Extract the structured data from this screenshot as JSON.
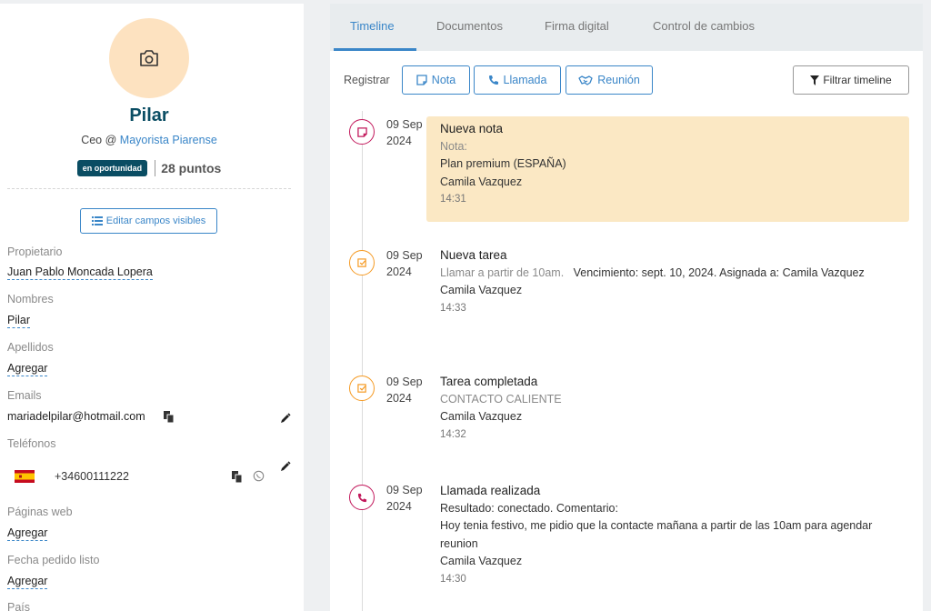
{
  "profile": {
    "name": "Pilar",
    "role": "Ceo @",
    "company": "Mayorista Piarense",
    "badge": "en oportunidad",
    "points": "28 puntos",
    "edit_fields_label": "Editar campos visibles"
  },
  "fields": {
    "owner_label": "Propietario",
    "owner_value": "Juan Pablo Moncada Lopera",
    "names_label": "Nombres",
    "names_value": "Pilar",
    "surnames_label": "Apellidos",
    "surnames_value": "Agregar",
    "emails_label": "Emails",
    "email_value": "mariadelpilar@hotmail.com",
    "phones_label": "Teléfonos",
    "phone_value": "+34600111222",
    "websites_label": "Páginas web",
    "websites_value": "Agregar",
    "order_date_label": "Fecha pedido listo",
    "order_date_value": "Agregar",
    "country_label": "País"
  },
  "tabs": [
    "Timeline",
    "Documentos",
    "Firma digital",
    "Control de cambios"
  ],
  "toolbar": {
    "register_label": "Registrar",
    "note_label": "Nota",
    "call_label": "Llamada",
    "meeting_label": "Reunión",
    "filter_label": "Filtrar timeline"
  },
  "events": [
    {
      "date_day": "09 Sep",
      "date_year": "2024",
      "title": "Nueva nota",
      "line1": "Nota:",
      "line2": "Plan premium (ESPAÑA)",
      "author": "Camila Vazquez",
      "time": "14:31"
    },
    {
      "date_day": "09 Sep",
      "date_year": "2024",
      "title": "Nueva tarea",
      "detail_muted": "Llamar a partir de 10am.",
      "detail_rest": "Vencimiento: sept. 10, 2024.   Asignada a: Camila Vazquez",
      "author": "Camila Vazquez",
      "time": "14:33"
    },
    {
      "date_day": "09 Sep",
      "date_year": "2024",
      "title": "Tarea completada",
      "detail": "CONTACTO CALIENTE",
      "author": "Camila Vazquez",
      "time": "14:32"
    },
    {
      "date_day": "09 Sep",
      "date_year": "2024",
      "title": "Llamada realizada",
      "detail": "Resultado: conectado.   Comentario:",
      "comment": "Hoy tenia festivo, me pidio que la contacte mañana a partir de las 10am para agendar reunion",
      "author": "Camila Vazquez",
      "time": "14:30"
    }
  ],
  "icons": {
    "camera": "camera-icon",
    "note": "note-icon",
    "call": "phone-icon",
    "meeting": "handshake-icon",
    "filter": "filter-icon",
    "task": "checkbox-icon",
    "copy": "copy-icon",
    "edit": "pencil-icon",
    "whatsapp": "whatsapp-icon",
    "flag": "spain-flag-icon"
  },
  "colors": {
    "accent": "#3a86c8",
    "brand": "#0a4d63",
    "note_icon": "#c2185b",
    "task_icon": "#f59a23",
    "note_card": "#fbe8c4"
  }
}
